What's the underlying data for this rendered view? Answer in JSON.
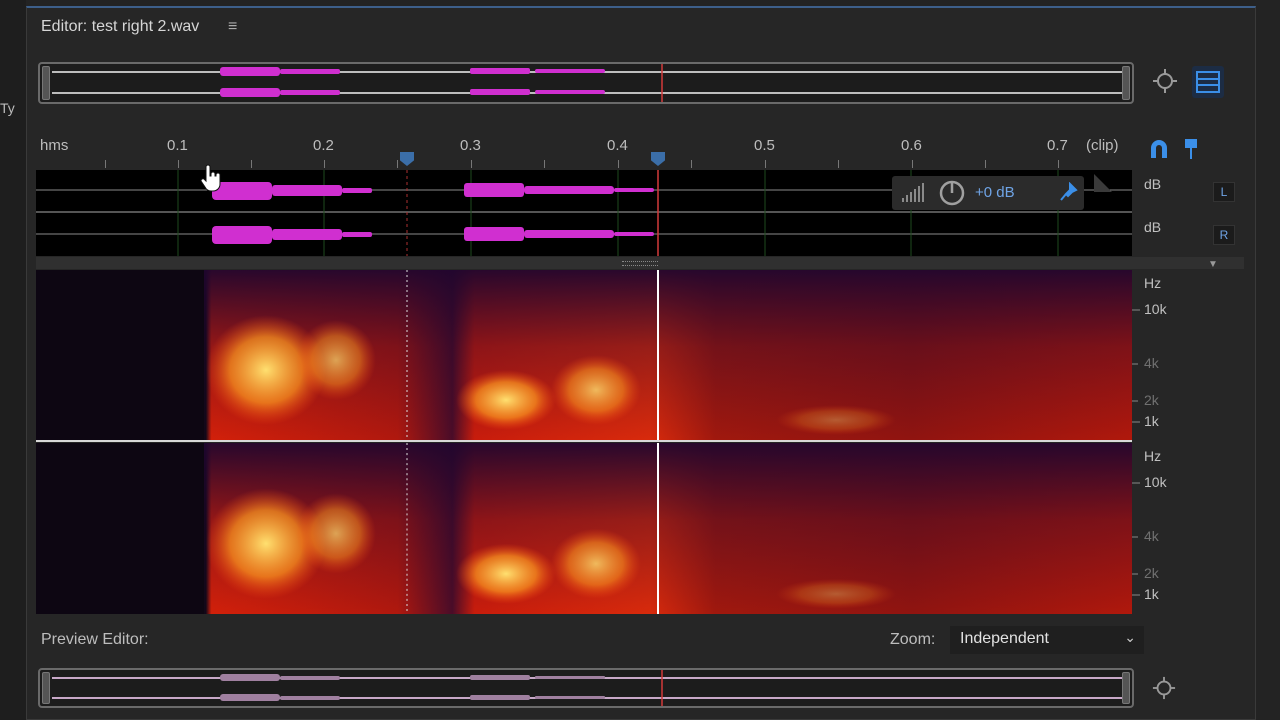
{
  "sidebar": {
    "clipped_text": "Ty"
  },
  "editor": {
    "title": "Editor: test right 2.wav",
    "menu_icon": "hamburger-menu-icon"
  },
  "toolbar": {
    "zoom_icon": "zoom-all-icon",
    "spectral_icon": "spectral-view-icon"
  },
  "ruler": {
    "unit": "hms",
    "ticks": [
      "0.1",
      "0.2",
      "0.3",
      "0.4",
      "0.5",
      "0.6",
      "0.7"
    ],
    "end_label": "(clip)"
  },
  "channels": [
    {
      "db_label": "dB",
      "button": "L"
    },
    {
      "db_label": "dB",
      "button": "R"
    }
  ],
  "gain_hud": {
    "value": "+0 dB",
    "knob_icon": "power-knob-icon",
    "pin_icon": "pin-icon"
  },
  "spectral": {
    "freq_unit": "Hz",
    "freq_labels": [
      "10k",
      "4k",
      "2k",
      "1k"
    ]
  },
  "preview": {
    "label": "Preview Editor:",
    "zoom_label": "Zoom:",
    "zoom_value": "Independent"
  },
  "colors": {
    "accent": "#3b6ea8",
    "waveform": "#d02fd0",
    "playhead": "#d33a3a",
    "spectrum_hot": "#ffd74a",
    "spectrum_mid": "#e23a10",
    "spectrum_low": "#2a0a3a"
  }
}
